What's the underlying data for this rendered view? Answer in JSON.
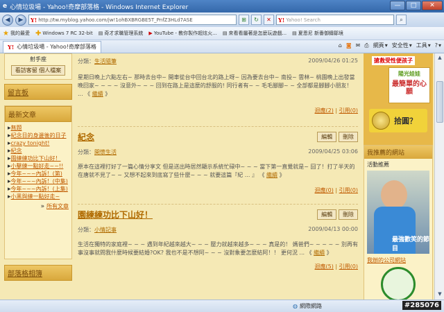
{
  "window": {
    "title": "心情垃圾場 - Yahoo!奇摩部落格 - Windows Internet Explorer",
    "min": "—",
    "max": "□",
    "close": "✕"
  },
  "address": {
    "url": "http://tw.myblog.yahoo.com/jw!1ohBXBRGBE5T_PnfZ3HLd7ASE",
    "search_placeholder": "Yahoo! Search"
  },
  "favorites": {
    "title": "我的最愛",
    "items": [
      "Windows 7 RC 32-bit",
      "奇才求職管理系統",
      "YouTube - 教你製作超炫火...",
      "來看看屬著是怎麼玩遊戲...",
      "夏恩尼 新番御鑄鄒境"
    ]
  },
  "tab": {
    "label": "心情垃圾場 - Yahoo!奇摩部落格"
  },
  "tools": {
    "page": "網頁",
    "safety": "安全性",
    "tools": "工具",
    "help": "?"
  },
  "left": {
    "top_text": "射手座",
    "guest_link": "看訪客留 個人檔案",
    "message_title": "留言板",
    "recent_title": "最新文章",
    "recent": [
      "無題",
      "紀念日的身邊後的日子",
      "crazy tonight!",
      "紀念",
      "園練練功比下山好！",
      "小擊練一點好走~~!!",
      "今年~~~內訴！(第)",
      "今年~~~內訴！(中集)",
      "今年~~~內訴！(上集)",
      "小黑與練一點好走~"
    ],
    "more": "所有文章",
    "album_title": "部落格相簿"
  },
  "posts": [
    {
      "cat_label": "分類：",
      "cat": "生活隨筆",
      "date": "2009/04/26 01:25",
      "title": "",
      "body": "星期日晚上六點左右~ 那時去台中~ 開車從台中回台北的路上呀~ 因為要去台中~ 南投~ 雲林~ 桃園晚上出發當晚回家~ ~ ~ ~ 沒意外~ ~ ~ 回到在路上是這麼的舒服的! 同行者有~ ~ 毛毛腳腳~ ~ 全部都是腳腳小朋友！ ...",
      "more": "繼續",
      "comments": "迴應(2)",
      "trackbacks": "引用(0)"
    },
    {
      "cat_label": "分類：",
      "cat": "開懷生活",
      "date": "2009/04/25 03:06",
      "title": "紀念",
      "body": "原本在這裡打好了一篇心情分享文 但是送出時居然顯示系統忙碌中~ ~ ~ 當下第一直覺就是~ 囧了！打了半天的在唐就不見了~ ~ 又想不起來到底寫了些什麼~ ~ ~ 就要這篇『紀 ... 』",
      "more": "繼續",
      "comments": "迴應(0)",
      "trackbacks": "引用(0)",
      "edit": "編輯",
      "del": "刪除"
    },
    {
      "cat_label": "分類：",
      "cat": "小情記事",
      "date": "2009/04/13 00:00",
      "title": "園練練功比下山好！",
      "body": "生活在獨特的家庭裡~ ~ ~ 遇到年紀越來越大~ ~ ~ 壓力就越來越多~ ~ ~ 真是的！ 媽爸們~ ~ ~ ~ ~ 別再有事沒事就問我什麼時候要結婚?OK? 我也不是不想阿~ ~ ~ 沒對象要怎麼結阿！！ 更何況 ...",
      "more": "繼續",
      "comments": "迴應(5)",
      "trackbacks": "引用(0)",
      "edit": "編輯",
      "del": "刪除"
    }
  ],
  "right": {
    "ad_text1": "搶救受性便孩子",
    "ad_text2": "陽光娃娃",
    "ad_text3": "最簡單的心願",
    "ad_text4": "拾圓？",
    "rec_title": "我推薦的網站",
    "rec_label": "活動推薦",
    "photo_caption": "最強歡笑的節目",
    "company_link": "我辦的公司網站"
  },
  "status": {
    "zone": "網際網路",
    "zoom": "100%",
    "watermark": "#285076"
  }
}
